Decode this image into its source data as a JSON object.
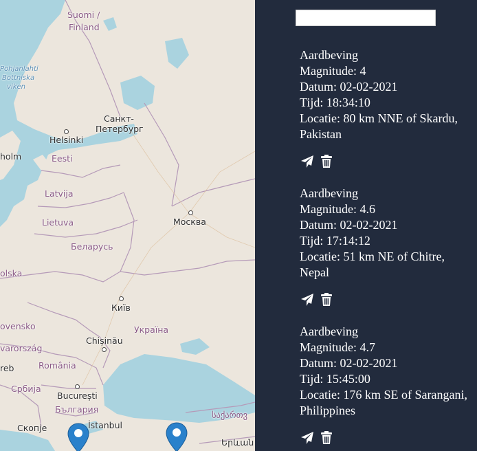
{
  "map": {
    "labels": {
      "suomi": "Suomi /",
      "finland": "Finland",
      "pohjanlahti": "Pohjanlahti",
      "bottniska": "Bottniska",
      "viken": "viken",
      "sankt": "Санкт-",
      "peterburg": "Петербург",
      "helsinki": "Helsinki",
      "holm": "holm",
      "eesti": "Eesti",
      "latvija": "Latvija",
      "lietuva": "Lietuva",
      "moskva": "Москва",
      "belarus": "Беларусь",
      "olska": "olska",
      "kyiv": "Київ",
      "ovensko": "ovensko",
      "ukraina": "Україна",
      "chisinau": "Chișinău",
      "varorszag": "varország",
      "reb": "reb",
      "romania": "România",
      "srbija": "Србија",
      "bucuresti": "București",
      "bulgaria": "България",
      "istanbul": "İstanbul",
      "skopje": "Скопје",
      "sakartvelo": "საქართვ",
      "yerevan": "Երևան"
    }
  },
  "sidebar": {
    "search_value": "",
    "quakes": [
      {
        "type": "Aardbeving",
        "magnitude": "Magnitude: 4",
        "datum": "Datum: 02-02-2021",
        "tijd": "Tijd: 18:34:10",
        "locatie": "Locatie: 80 km NNE of Skardu, Pakistan"
      },
      {
        "type": "Aardbeving",
        "magnitude": "Magnitude: 4.6",
        "datum": "Datum: 02-02-2021",
        "tijd": "Tijd: 17:14:12",
        "locatie": "Locatie: 51 km NE of Chitre, Nepal"
      },
      {
        "type": "Aardbeving",
        "magnitude": "Magnitude: 4.7",
        "datum": "Datum: 02-02-2021",
        "tijd": "Tijd: 15:45:00",
        "locatie": "Locatie: 176 km SE of Sarangani, Philippines"
      }
    ]
  },
  "colors": {
    "sidebar_bg": "#222b3d",
    "water": "#aad3df",
    "land": "#ece6dd",
    "border": "#b59ab8",
    "marker": "#2a81cb"
  },
  "icons": {
    "send": "paper-plane-icon",
    "delete": "trash-icon",
    "marker": "map-marker-icon"
  }
}
